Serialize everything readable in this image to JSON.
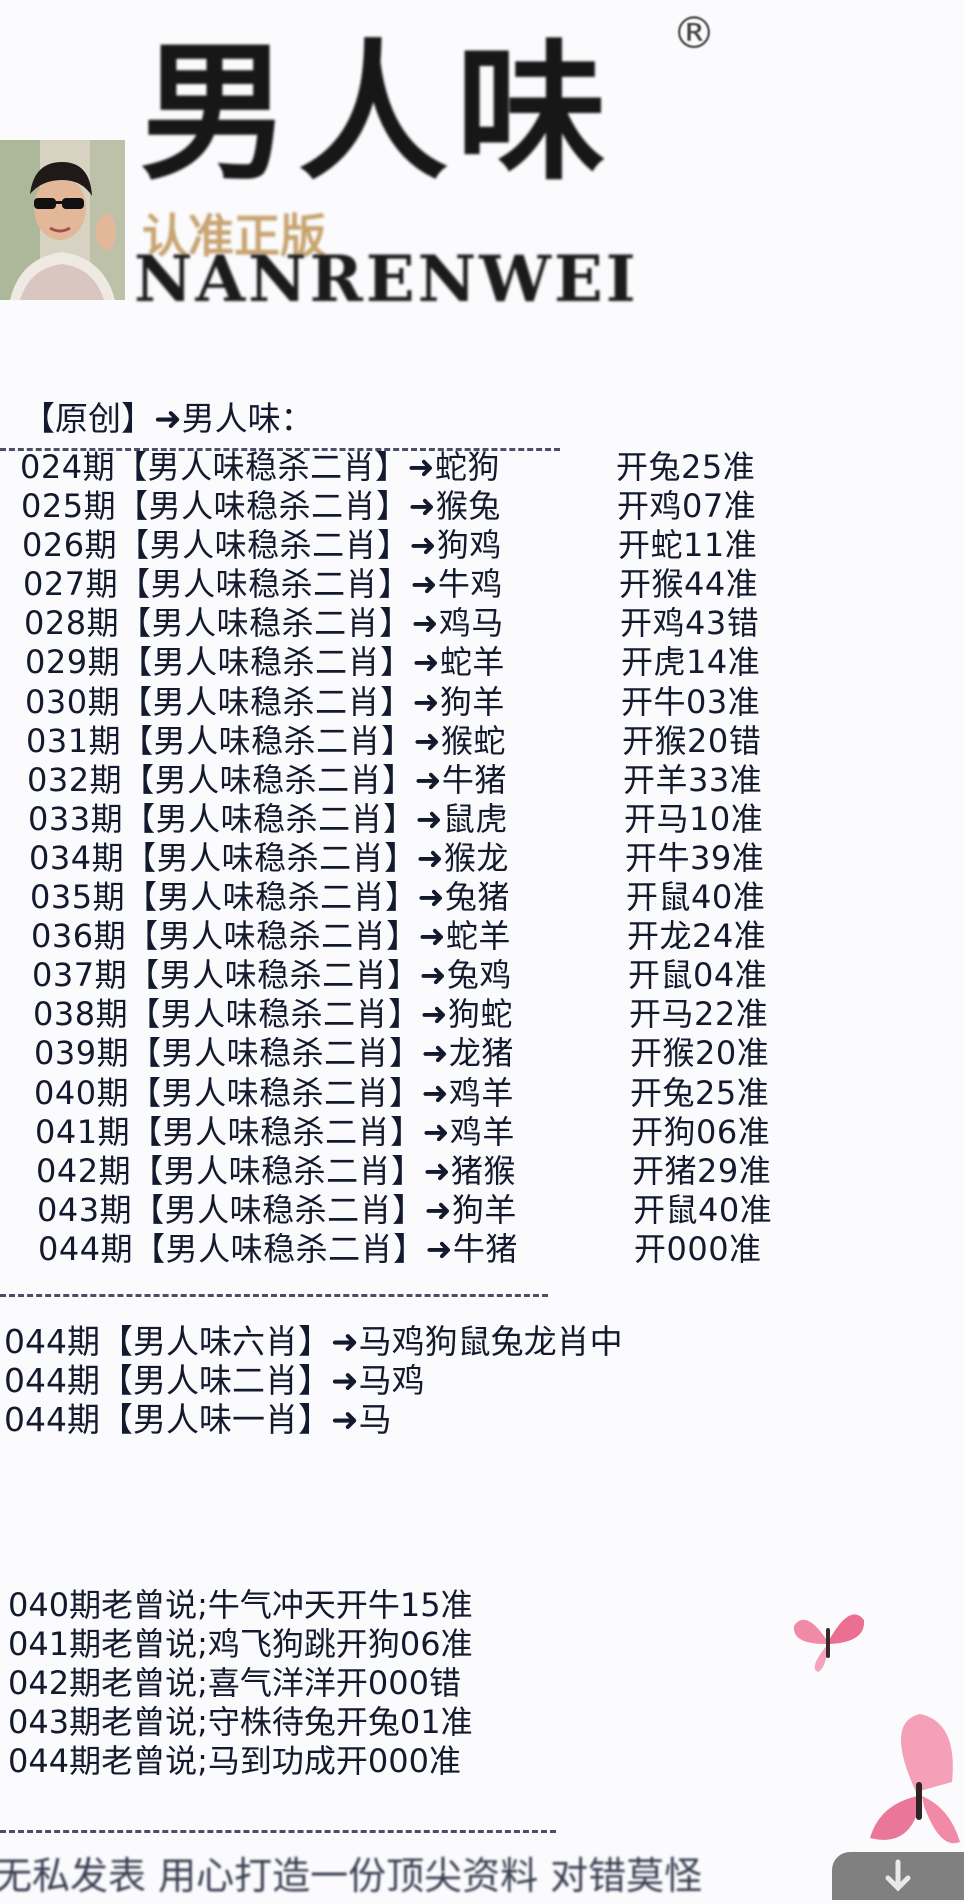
{
  "header": {
    "brand_cn": "男人味",
    "reg_mark": "®",
    "slogan": "认准正版",
    "brand_en": "NANRENWEI"
  },
  "section_title": "【原创】➜男人味：",
  "predictions": [
    {
      "period": "024期",
      "label": "【男人味稳杀二肖】",
      "arrow": "➜",
      "pick": "蛇狗",
      "result": "开兔25准"
    },
    {
      "period": "025期",
      "label": "【男人味稳杀二肖】",
      "arrow": "➜",
      "pick": "猴兔",
      "result": "开鸡07准"
    },
    {
      "period": "026期",
      "label": "【男人味稳杀二肖】",
      "arrow": "➜",
      "pick": "狗鸡",
      "result": "开蛇11准"
    },
    {
      "period": "027期",
      "label": "【男人味稳杀二肖】",
      "arrow": "➜",
      "pick": "牛鸡",
      "result": "开猴44准"
    },
    {
      "period": "028期",
      "label": "【男人味稳杀二肖】",
      "arrow": "➜",
      "pick": "鸡马",
      "result": "开鸡43错"
    },
    {
      "period": "029期",
      "label": "【男人味稳杀二肖】",
      "arrow": "➜",
      "pick": "蛇羊",
      "result": "开虎14准"
    },
    {
      "period": "030期",
      "label": "【男人味稳杀二肖】",
      "arrow": "➜",
      "pick": "狗羊",
      "result": "开牛03准"
    },
    {
      "period": "031期",
      "label": "【男人味稳杀二肖】",
      "arrow": "➜",
      "pick": "猴蛇",
      "result": "开猴20错"
    },
    {
      "period": "032期",
      "label": "【男人味稳杀二肖】",
      "arrow": "➜",
      "pick": "牛猪",
      "result": "开羊33准"
    },
    {
      "period": "033期",
      "label": "【男人味稳杀二肖】",
      "arrow": "➜",
      "pick": "鼠虎",
      "result": "开马10准"
    },
    {
      "period": "034期",
      "label": "【男人味稳杀二肖】",
      "arrow": "➜",
      "pick": "猴龙",
      "result": "开牛39准"
    },
    {
      "period": "035期",
      "label": "【男人味稳杀二肖】",
      "arrow": "➜",
      "pick": "兔猪",
      "result": "开鼠40准"
    },
    {
      "period": "036期",
      "label": "【男人味稳杀二肖】",
      "arrow": "➜",
      "pick": "蛇羊",
      "result": "开龙24准"
    },
    {
      "period": "037期",
      "label": "【男人味稳杀二肖】",
      "arrow": "➜",
      "pick": "兔鸡",
      "result": "开鼠04准"
    },
    {
      "period": "038期",
      "label": "【男人味稳杀二肖】",
      "arrow": "➜",
      "pick": "狗蛇",
      "result": "开马22准"
    },
    {
      "period": "039期",
      "label": "【男人味稳杀二肖】",
      "arrow": "➜",
      "pick": "龙猪",
      "result": "开猴20准"
    },
    {
      "period": "040期",
      "label": "【男人味稳杀二肖】",
      "arrow": "➜",
      "pick": "鸡羊",
      "result": "开兔25准"
    },
    {
      "period": "041期",
      "label": "【男人味稳杀二肖】",
      "arrow": "➜",
      "pick": "鸡羊",
      "result": "开狗06准"
    },
    {
      "period": "042期",
      "label": "【男人味稳杀二肖】",
      "arrow": "➜",
      "pick": "猪猴",
      "result": "开猪29准"
    },
    {
      "period": "043期",
      "label": "【男人味稳杀二肖】",
      "arrow": "➜",
      "pick": "狗羊",
      "result": "开鼠40准"
    },
    {
      "period": "044期",
      "label": "【男人味稳杀二肖】",
      "arrow": "➜",
      "pick": "牛猪",
      "result": "开000准"
    }
  ],
  "picks": [
    "044期【男人味六肖】➜马鸡狗鼠兔龙肖中",
    "044期【男人味二肖】➜马鸡",
    "044期【男人味一肖】➜马"
  ],
  "sayings": [
    "040期老曾说;牛气冲天开牛15准",
    "041期老曾说;鸡飞狗跳开狗06准",
    "042期老曾说;喜气洋洋开000错",
    "043期老曾说;守株待兔开兔01准",
    "044期老曾说;马到功成开000准"
  ],
  "footer_text": "无私发表 用心打造一份顶尖资料 对错莫怪",
  "colors": {
    "text": "#141a2e",
    "slogan_gold": "#c7a36f",
    "butterfly_pink": "#f08aa6"
  }
}
